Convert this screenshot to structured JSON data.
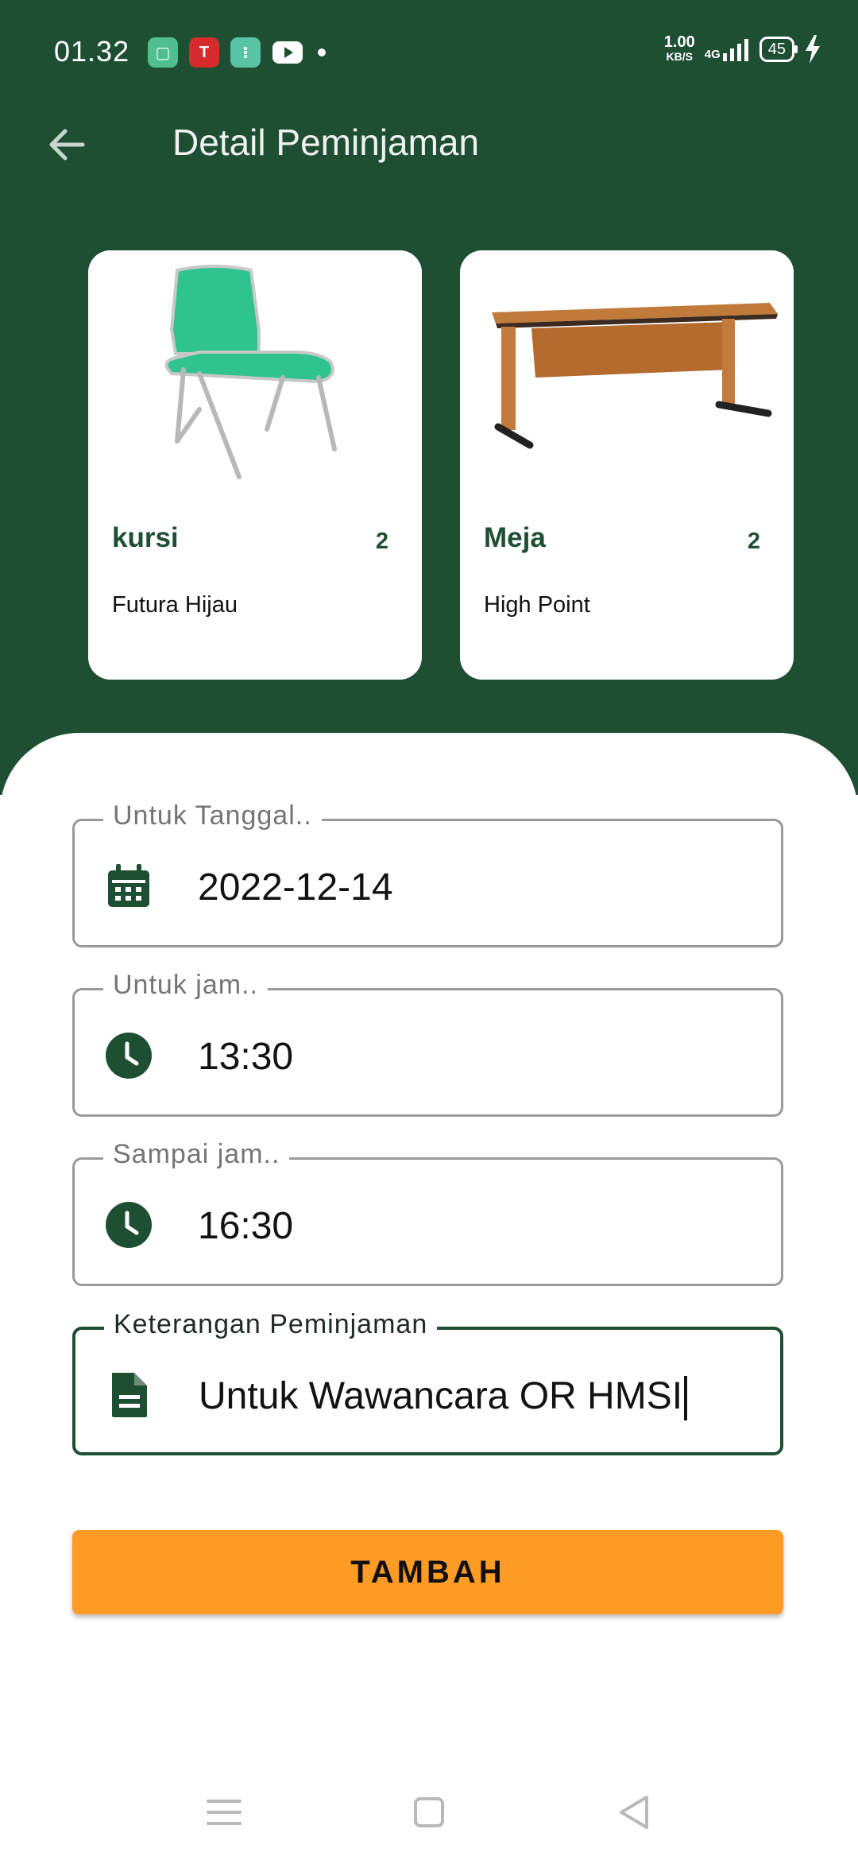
{
  "status_bar": {
    "time": "01.32",
    "speed_value": "1.00",
    "speed_unit": "KB/S",
    "network": "4G",
    "battery": "45"
  },
  "app_bar": {
    "title": "Detail Peminjaman"
  },
  "items": [
    {
      "name": "kursi",
      "qty": "2",
      "subtitle": "Futura Hijau"
    },
    {
      "name": "Meja",
      "qty": "2",
      "subtitle": "High Point"
    }
  ],
  "form": {
    "date_label": "Untuk Tanggal..",
    "date_value": "2022-12-14",
    "start_label": "Untuk jam..",
    "start_value": "13:30",
    "end_label": "Sampai jam..",
    "end_value": "16:30",
    "note_label": "Keterangan Peminjaman",
    "note_value": "Untuk Wawancara OR HMSI"
  },
  "submit_label": "TAMBAH",
  "colors": {
    "primary": "#1f4f33",
    "accent": "#ff9c26"
  }
}
